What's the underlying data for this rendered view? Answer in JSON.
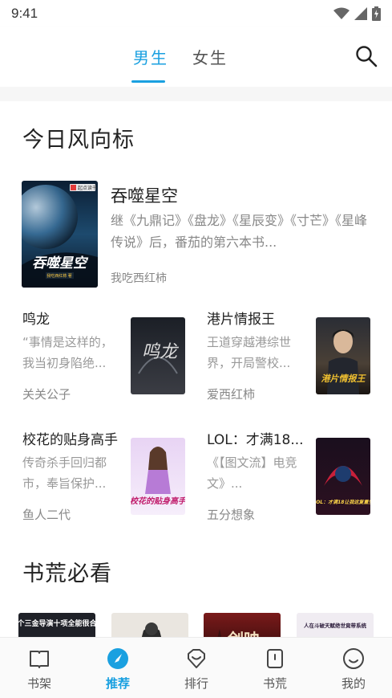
{
  "status_bar": {
    "time": "9:41"
  },
  "top_tabs": [
    {
      "label": "男生",
      "active": true
    },
    {
      "label": "女生",
      "active": false
    }
  ],
  "sections": {
    "today": {
      "title": "今日风向标",
      "featured": {
        "title": "吞噬星空",
        "description": "继《九鼎记》《盘龙》《星辰变》《寸芒》《星峰传说》后，番茄的第六本书...",
        "author": "我吃西红柿",
        "cover_text": "吞噬星空",
        "cover_badge": "起点读书",
        "cover_sub": "我吃西红柿 著"
      },
      "grid": [
        {
          "title": "鸣龙",
          "description": "“事情是这样的，我当初身陷绝...",
          "author": "关关公子",
          "cover_text": "鸣龙"
        },
        {
          "title": "港片情报王",
          "description": "王道穿越港综世界，开局警校...",
          "author": "爱西红柿",
          "cover_text": "港片情报王"
        },
        {
          "title": "校花的贴身高手",
          "description": "传奇杀手回归都市，奉旨保护...",
          "author": "鱼人二代",
          "cover_text": "校花的贴身高手"
        },
        {
          "title": "LOL：才满18...",
          "description": "《【图文流】电竞文》...",
          "author": "五分想象",
          "cover_text": "LOL：才满18让我这复重生"
        }
      ]
    },
    "must_read": {
      "title": "书荒必看",
      "covers": [
        {
          "text": "我一个三金导演十项全能很合理吧"
        },
        {
          "text": ""
        },
        {
          "text": "剑映"
        },
        {
          "text": "人在斗破天赋绝世竟带系统"
        }
      ]
    }
  },
  "bottom_nav": [
    {
      "label": "书架",
      "icon": "bookshelf-icon",
      "active": false
    },
    {
      "label": "推荐",
      "icon": "compass-icon",
      "active": true
    },
    {
      "label": "排行",
      "icon": "ranking-icon",
      "active": false
    },
    {
      "label": "书荒",
      "icon": "book-icon",
      "active": false
    },
    {
      "label": "我的",
      "icon": "profile-icon",
      "active": false
    }
  ],
  "colors": {
    "accent": "#1aa0e0",
    "text_primary": "#222222",
    "text_secondary": "#888888"
  }
}
